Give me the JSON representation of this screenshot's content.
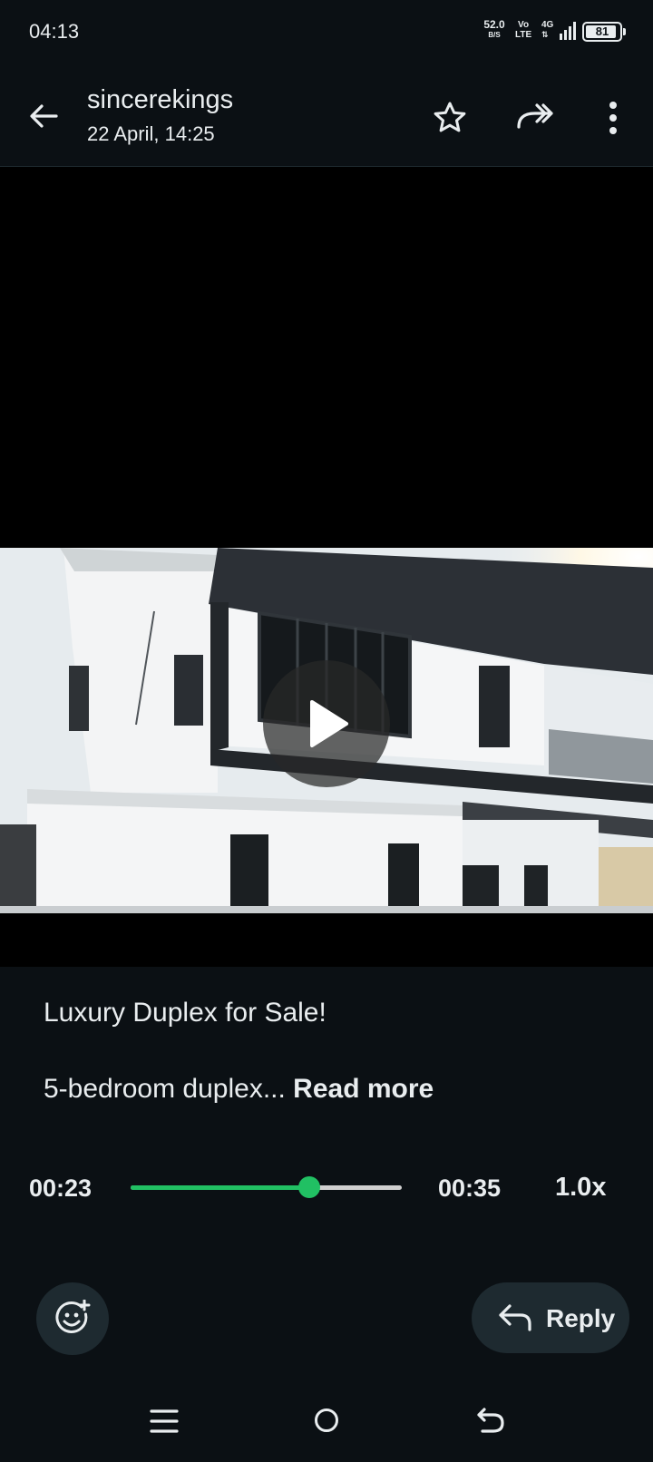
{
  "status_bar": {
    "time": "04:13",
    "net_speed_value": "52.0",
    "net_speed_unit": "B/S",
    "volte_top": "Vo",
    "volte_bottom": "LTE",
    "network_type": "4G",
    "battery_level": "81"
  },
  "header": {
    "sender_name": "sincerekings",
    "timestamp": "22 April, 14:25",
    "icons": [
      "arrow-left-icon",
      "star-icon",
      "forward-icon",
      "more-vert-icon"
    ]
  },
  "media": {
    "type": "video",
    "play_icon": "play-icon"
  },
  "caption": {
    "title": "Luxury Duplex for Sale!",
    "body": "5-bedroom duplex...",
    "read_more": "Read more"
  },
  "playback": {
    "current_time": "00:23",
    "total_time": "00:35",
    "progress_fraction": 0.66,
    "speed": "1.0x",
    "accent_color": "#21c063"
  },
  "actions": {
    "emoji_icon": "emoji-add-icon",
    "reply_label": "Reply",
    "reply_icon": "reply-icon"
  },
  "nav_bar": {
    "icons": [
      "menu-icon",
      "home-icon",
      "back-icon"
    ]
  }
}
